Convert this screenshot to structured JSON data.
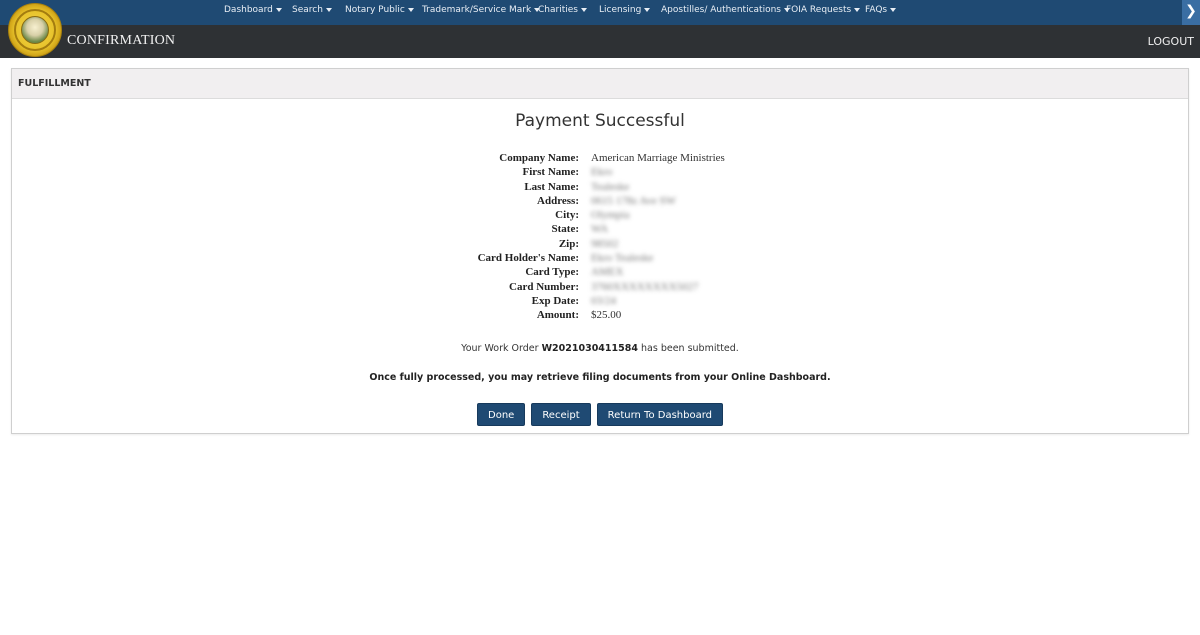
{
  "nav": {
    "items": [
      {
        "label": "Dashboard"
      },
      {
        "label": "Search"
      },
      {
        "label": "Notary Public"
      },
      {
        "label": "Trademark/Service Mark"
      },
      {
        "label": "Charities"
      },
      {
        "label": "Licensing"
      },
      {
        "label": "Apostilles/ Authentications"
      },
      {
        "label": "FOIA Requests"
      },
      {
        "label": "FAQs"
      }
    ],
    "toggle_icon": "chevron-right"
  },
  "header": {
    "title": "CONFIRMATION",
    "logout_label": "LOGOUT",
    "logo": "secretary-of-state-seal"
  },
  "panel": {
    "heading": "FULFILLMENT",
    "result_title": "Payment Successful",
    "fields": [
      {
        "label": "Company Name:",
        "value": "American Marriage Ministries",
        "redacted": false
      },
      {
        "label": "First Name:",
        "value": "Ekro",
        "redacted": true
      },
      {
        "label": "Last Name:",
        "value": "Tealeske",
        "redacted": true
      },
      {
        "label": "Address:",
        "value": "0615 178z Ave SW",
        "redacted": true
      },
      {
        "label": "City:",
        "value": "Olympia",
        "redacted": true
      },
      {
        "label": "State:",
        "value": "WA",
        "redacted": true
      },
      {
        "label": "Zip:",
        "value": "98502",
        "redacted": true
      },
      {
        "label": "Card Holder's Name:",
        "value": "Ekro Tealeske",
        "redacted": true
      },
      {
        "label": "Card Type:",
        "value": "AMEX",
        "redacted": true
      },
      {
        "label": "Card Number:",
        "value": "3760XXXXXXXX5027",
        "redacted": true
      },
      {
        "label": "Exp Date:",
        "value": "03/24",
        "redacted": true
      },
      {
        "label": "Amount:",
        "value": "$25.00",
        "redacted": false
      }
    ],
    "work_order_prefix": "Your Work Order",
    "work_order_number": "W2021030411584",
    "work_order_suffix": "has been submitted.",
    "note": "Once fully processed, you may retrieve filing documents from your Online Dashboard.",
    "buttons": {
      "done": "Done",
      "receipt": "Receipt",
      "return_dashboard": "Return To Dashboard"
    }
  },
  "colors": {
    "nav_bg": "#1f4a73",
    "titlebar_bg": "#2e3134",
    "button_bg": "#1f4a73",
    "panel_heading_bg": "#f1eff0"
  }
}
